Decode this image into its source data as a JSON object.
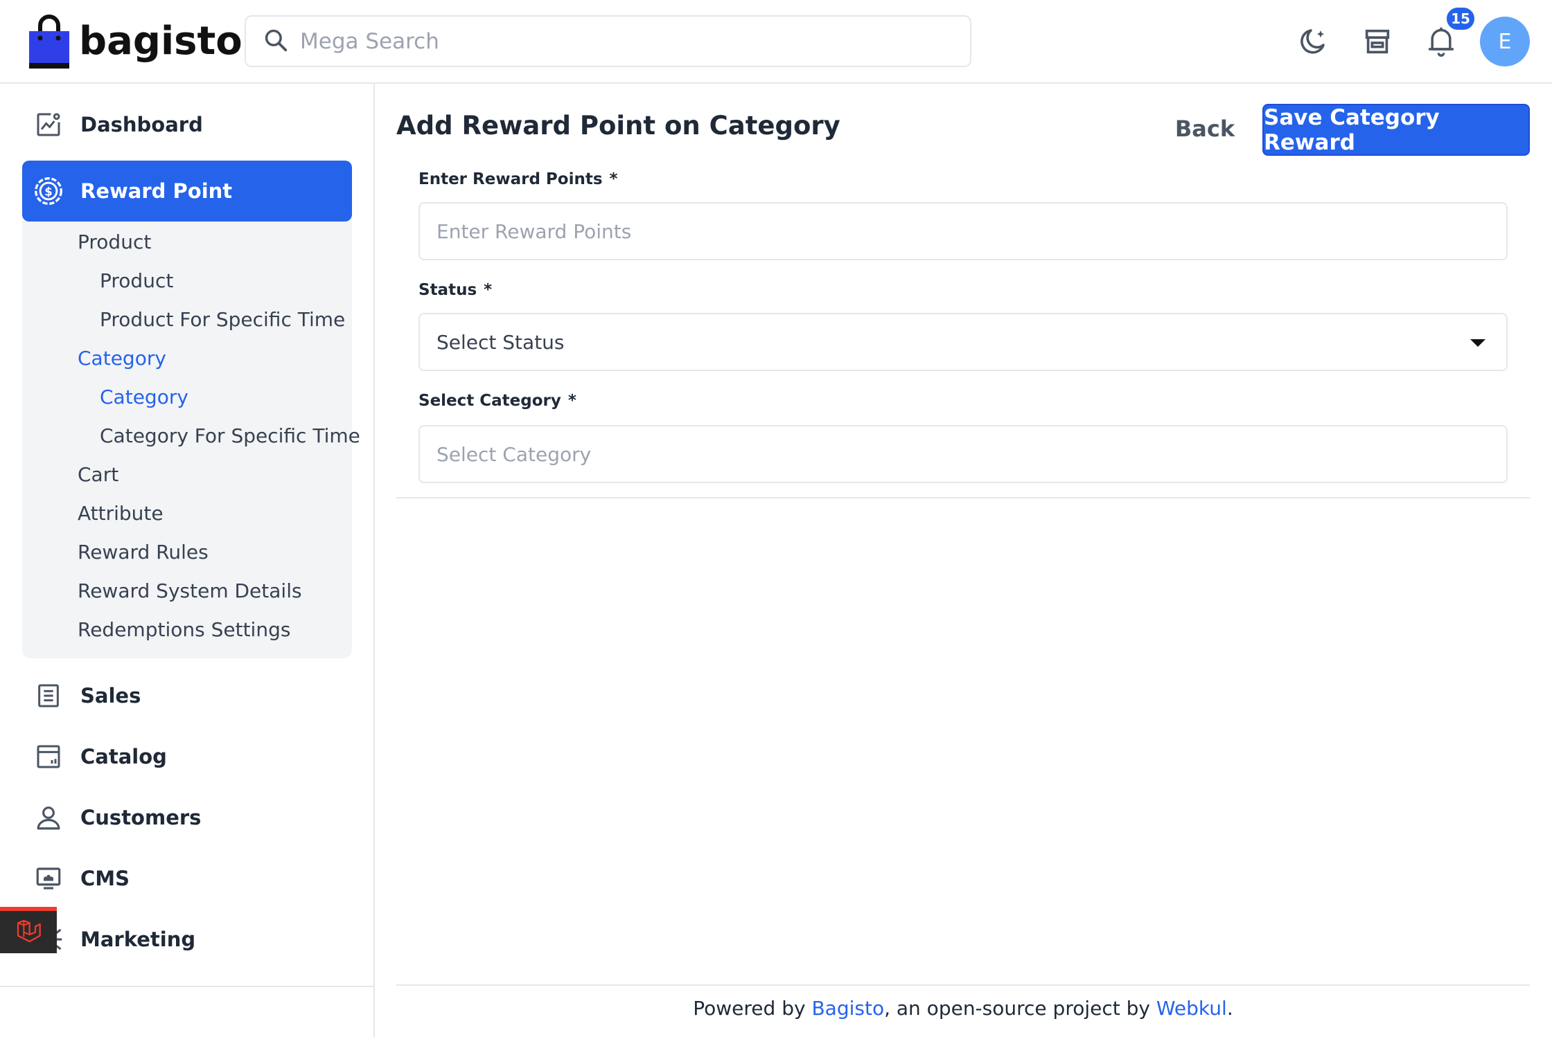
{
  "header": {
    "logo_text": "bagisto",
    "search_placeholder": "Mega Search",
    "notification_count": "15",
    "avatar_initial": "E"
  },
  "sidebar": {
    "items": [
      {
        "label": "Dashboard",
        "icon": "dashboard-icon"
      },
      {
        "label": "Reward Point",
        "icon": "reward-point-icon",
        "active": true
      },
      {
        "label": "Sales",
        "icon": "sales-icon"
      },
      {
        "label": "Catalog",
        "icon": "catalog-icon"
      },
      {
        "label": "Customers",
        "icon": "customers-icon"
      },
      {
        "label": "CMS",
        "icon": "cms-icon"
      },
      {
        "label": "Marketing",
        "icon": "marketing-icon"
      }
    ],
    "submenu": [
      {
        "label": "Product",
        "level": 1
      },
      {
        "label": "Product",
        "level": 2
      },
      {
        "label": "Product For Specific Time",
        "level": 2
      },
      {
        "label": "Category",
        "level": 1,
        "active": true
      },
      {
        "label": "Category",
        "level": 2,
        "active": true
      },
      {
        "label": "Category For Specific Time",
        "level": 2
      },
      {
        "label": "Cart",
        "level": 1
      },
      {
        "label": "Attribute",
        "level": 1
      },
      {
        "label": "Reward Rules",
        "level": 1
      },
      {
        "label": "Reward System Details",
        "level": 1
      },
      {
        "label": "Redemptions Settings",
        "level": 1
      }
    ]
  },
  "page": {
    "title": "Add Reward Point on Category",
    "back_label": "Back",
    "save_label": "Save Category Reward"
  },
  "form": {
    "reward_points": {
      "label": "Enter Reward Points",
      "required": "*",
      "placeholder": "Enter Reward Points"
    },
    "status": {
      "label": "Status",
      "required": "*",
      "value": "Select Status"
    },
    "category": {
      "label": "Select Category",
      "required": "*",
      "placeholder": "Select Category"
    }
  },
  "footer": {
    "prefix": "Powered by ",
    "link1": "Bagisto",
    "middle": ", an open-source project by ",
    "link2": "Webkul",
    "suffix": "."
  },
  "colors": {
    "accent": "#2563eb",
    "avatar": "#60a5fa",
    "laravel_red": "#ef3b2d"
  }
}
